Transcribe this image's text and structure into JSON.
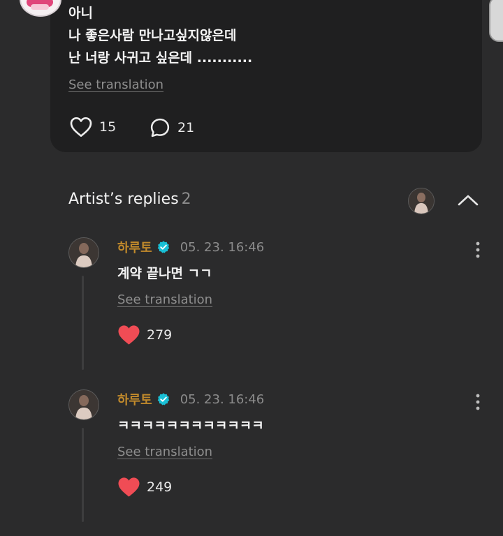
{
  "post": {
    "lines": [
      "아니",
      "나 좋은사람 만나고싶지않은데",
      "난 너랑 사귀고 싶은데 ..........."
    ],
    "see_translation": "See translation",
    "like_count": "15",
    "comment_count": "21"
  },
  "artist_replies": {
    "title": "Artist’s replies",
    "count": "2",
    "replies": [
      {
        "author": "하루토",
        "date": "05. 23. 16:46",
        "text": "계약 끝나면 ㄱㄱ",
        "see_translation": "See translation",
        "like_count": "279"
      },
      {
        "author": "하루토",
        "date": "05. 23. 16:46",
        "text": "ㅋㅋㅋㅋㅋㅋㅋㅋㅋㅋㅋㅋ",
        "see_translation": "See translation",
        "like_count": "249"
      }
    ]
  },
  "icons": {
    "like": "heart-outline-icon",
    "comment": "comment-bubble-icon",
    "liked": "heart-filled-icon",
    "verified": "verified-badge-icon",
    "collapse": "chevron-up-icon",
    "more": "more-vertical-icon"
  },
  "colors": {
    "background": "#2b2b2c",
    "card": "#1f1f20",
    "author": "#c18a2b",
    "verified": "#19c0d6",
    "liked_heart": "#f04c55",
    "muted_text": "#8e8e8e"
  }
}
